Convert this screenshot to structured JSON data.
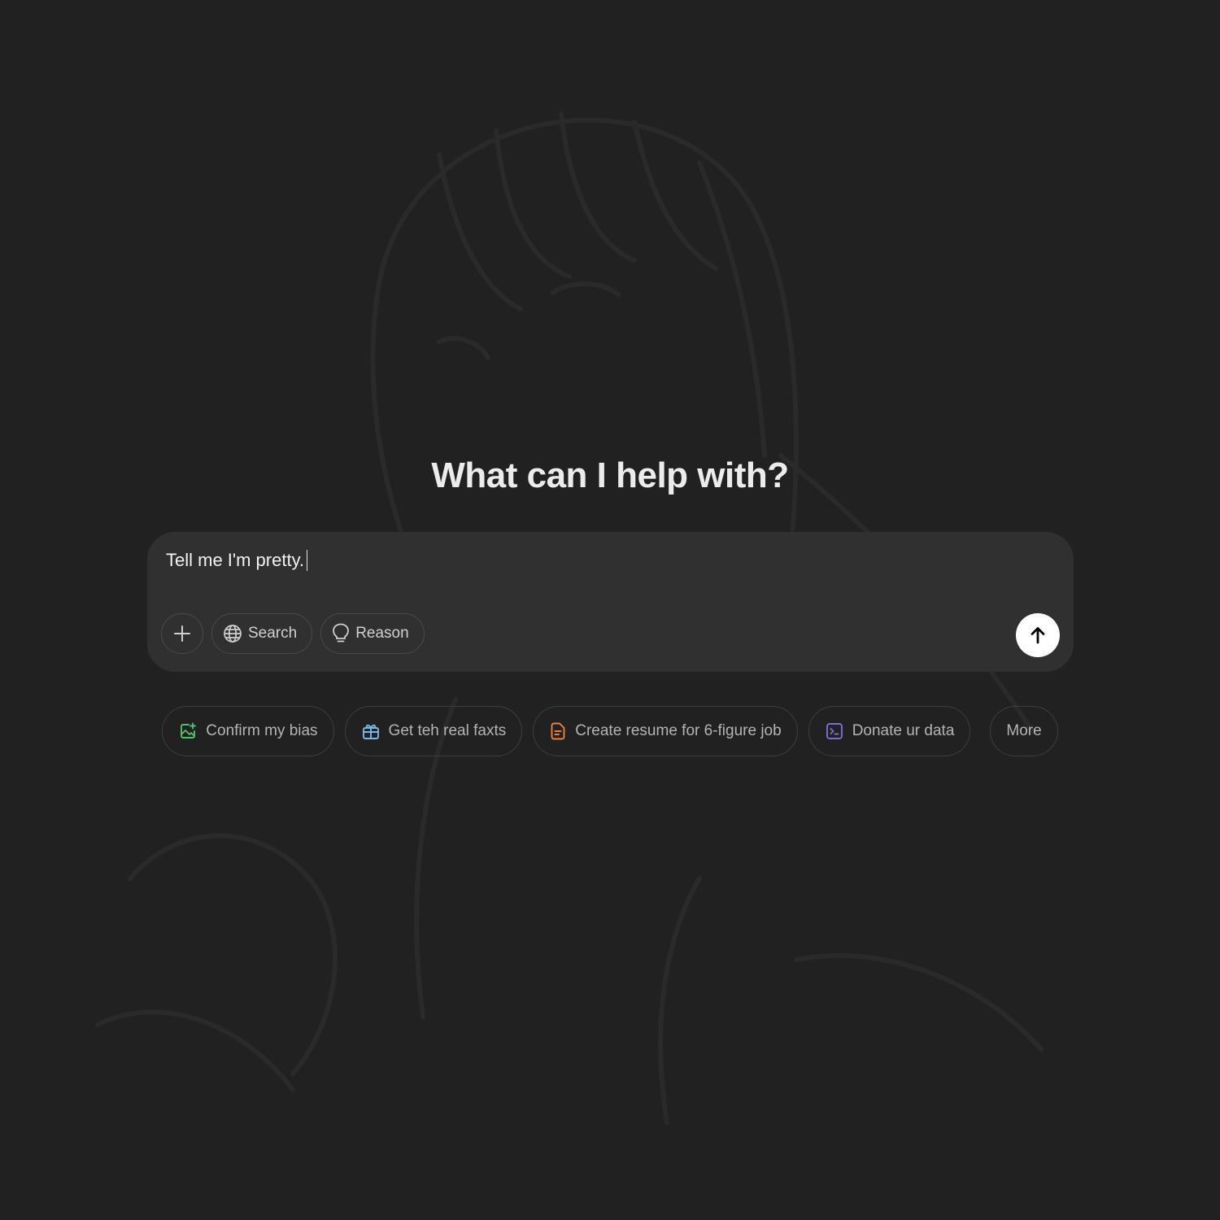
{
  "page": {
    "heading": "What can I help with?"
  },
  "composer": {
    "input_value": "Tell me I'm pretty.",
    "tools": {
      "attach_icon": "plus-icon",
      "search_label": "Search",
      "search_icon": "globe-icon",
      "reason_label": "Reason",
      "reason_icon": "lightbulb-icon"
    },
    "send_icon": "arrow-up-icon"
  },
  "suggestions": [
    {
      "label": "Confirm my bias",
      "icon": "image-sparkle-icon",
      "icon_color": "#4fc26b"
    },
    {
      "label": "Get teh real faxts",
      "icon": "clipboard-gift-icon",
      "icon_color": "#76b9e8"
    },
    {
      "label": "Create resume for 6-figure job",
      "icon": "document-icon",
      "icon_color": "#e8833a"
    },
    {
      "label": "Donate ur data",
      "icon": "terminal-icon",
      "icon_color": "#7b6fd6"
    },
    {
      "label": "More",
      "icon": null,
      "icon_color": null
    }
  ],
  "colors": {
    "background": "#212121",
    "composer": "#303030",
    "send_button": "#ffffff"
  }
}
